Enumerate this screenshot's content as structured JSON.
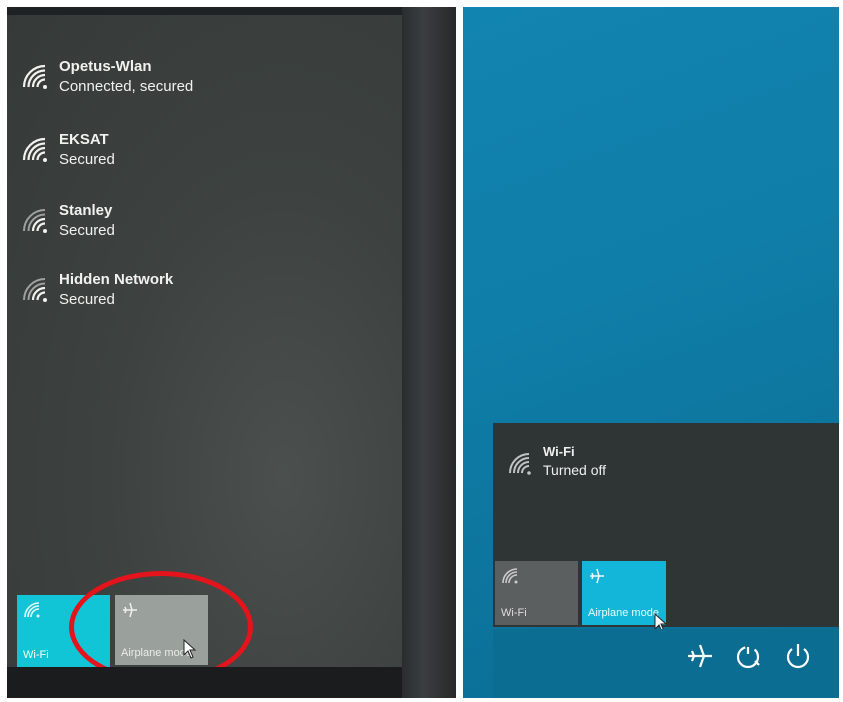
{
  "left_panel": {
    "networks": [
      {
        "ssid": "Opetus-Wlan",
        "status": "Connected, secured",
        "icon": "wifi-icon"
      },
      {
        "ssid": "EKSAT",
        "status": "Secured",
        "icon": "wifi-icon"
      },
      {
        "ssid": "Stanley",
        "status": "Secured",
        "icon": "wifi-icon"
      },
      {
        "ssid": "Hidden Network",
        "status": "Secured",
        "icon": "wifi-icon"
      }
    ],
    "tiles": {
      "wifi": {
        "label": "Wi-Fi",
        "icon": "wifi-icon",
        "state": "on",
        "color": "#12c5d6"
      },
      "airplane": {
        "label": "Airplane mode",
        "icon": "airplane-icon",
        "state": "off",
        "color": "#9aa09c"
      }
    },
    "highlight_color": "#e5131b"
  },
  "right_panel": {
    "network": {
      "ssid": "Wi-Fi",
      "status": "Turned off",
      "icon": "wifi-icon"
    },
    "tiles": {
      "wifi": {
        "label": "Wi-Fi",
        "icon": "wifi-icon",
        "state": "off",
        "color": "#5b5f5f"
      },
      "airplane": {
        "label": "Airplane mode",
        "icon": "airplane-icon",
        "state": "on",
        "color": "#13b6d8"
      }
    },
    "tray_icons": [
      "airplane-icon",
      "sleep-icon",
      "power-icon"
    ]
  }
}
